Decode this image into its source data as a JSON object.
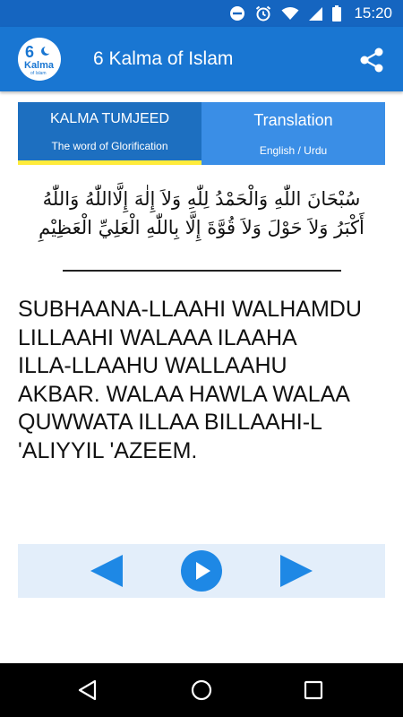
{
  "status_bar": {
    "time": "15:20",
    "icons": [
      "do-not-disturb-icon",
      "alarm-icon",
      "wifi-icon",
      "signal-icon",
      "battery-icon"
    ]
  },
  "app_bar": {
    "logo": {
      "number": "6",
      "word": "Kalma",
      "sub": "of Islam"
    },
    "title": "6 Kalma of Islam",
    "share_icon": "share-icon"
  },
  "tabs": [
    {
      "title": "KALMA TUMJEED",
      "subtitle": "The word of Glorification",
      "active": true
    },
    {
      "title": "Translation",
      "subtitle": "English / Urdu",
      "active": false
    }
  ],
  "content": {
    "arabic": "سُبْحَانَ اللّٰهِ وَالْحَمْدُ لِلّٰهِ وَلاَ إِلٰهَ إِلَّااللّٰهُ وَاللّٰهُ\nأَكْبَرُ وَلاَ حَوْلَ وَلاَ قُوَّةَ إِلَّا بِاللّٰهِ الْعَلِيِّ الْعَظِيْمِ",
    "transliteration": "SUBHAANA-LLAAHI WALHAMDU\nLILLAAHI WALAAA ILAAHA\nILLA-LLAAHU WALLAAHU\nAKBAR. WALAA HAWLA WALAA\nQUWWATA ILLAA BILLAAHI-L\n'ALIYYIL 'AZEEM."
  },
  "player": {
    "controls": [
      "previous-icon",
      "play-icon",
      "next-icon"
    ]
  },
  "nav_bar": {
    "buttons": [
      "back-icon",
      "home-icon",
      "recents-icon"
    ]
  },
  "colors": {
    "status_bar": "#1565c0",
    "app_bar": "#1976d2",
    "tab_active": "#1d6fc0",
    "tab_inactive": "#3a8ee6",
    "tab_indicator": "#ffeb3b",
    "player_bg": "#e3eefa",
    "control_blue": "#1e88e5"
  }
}
